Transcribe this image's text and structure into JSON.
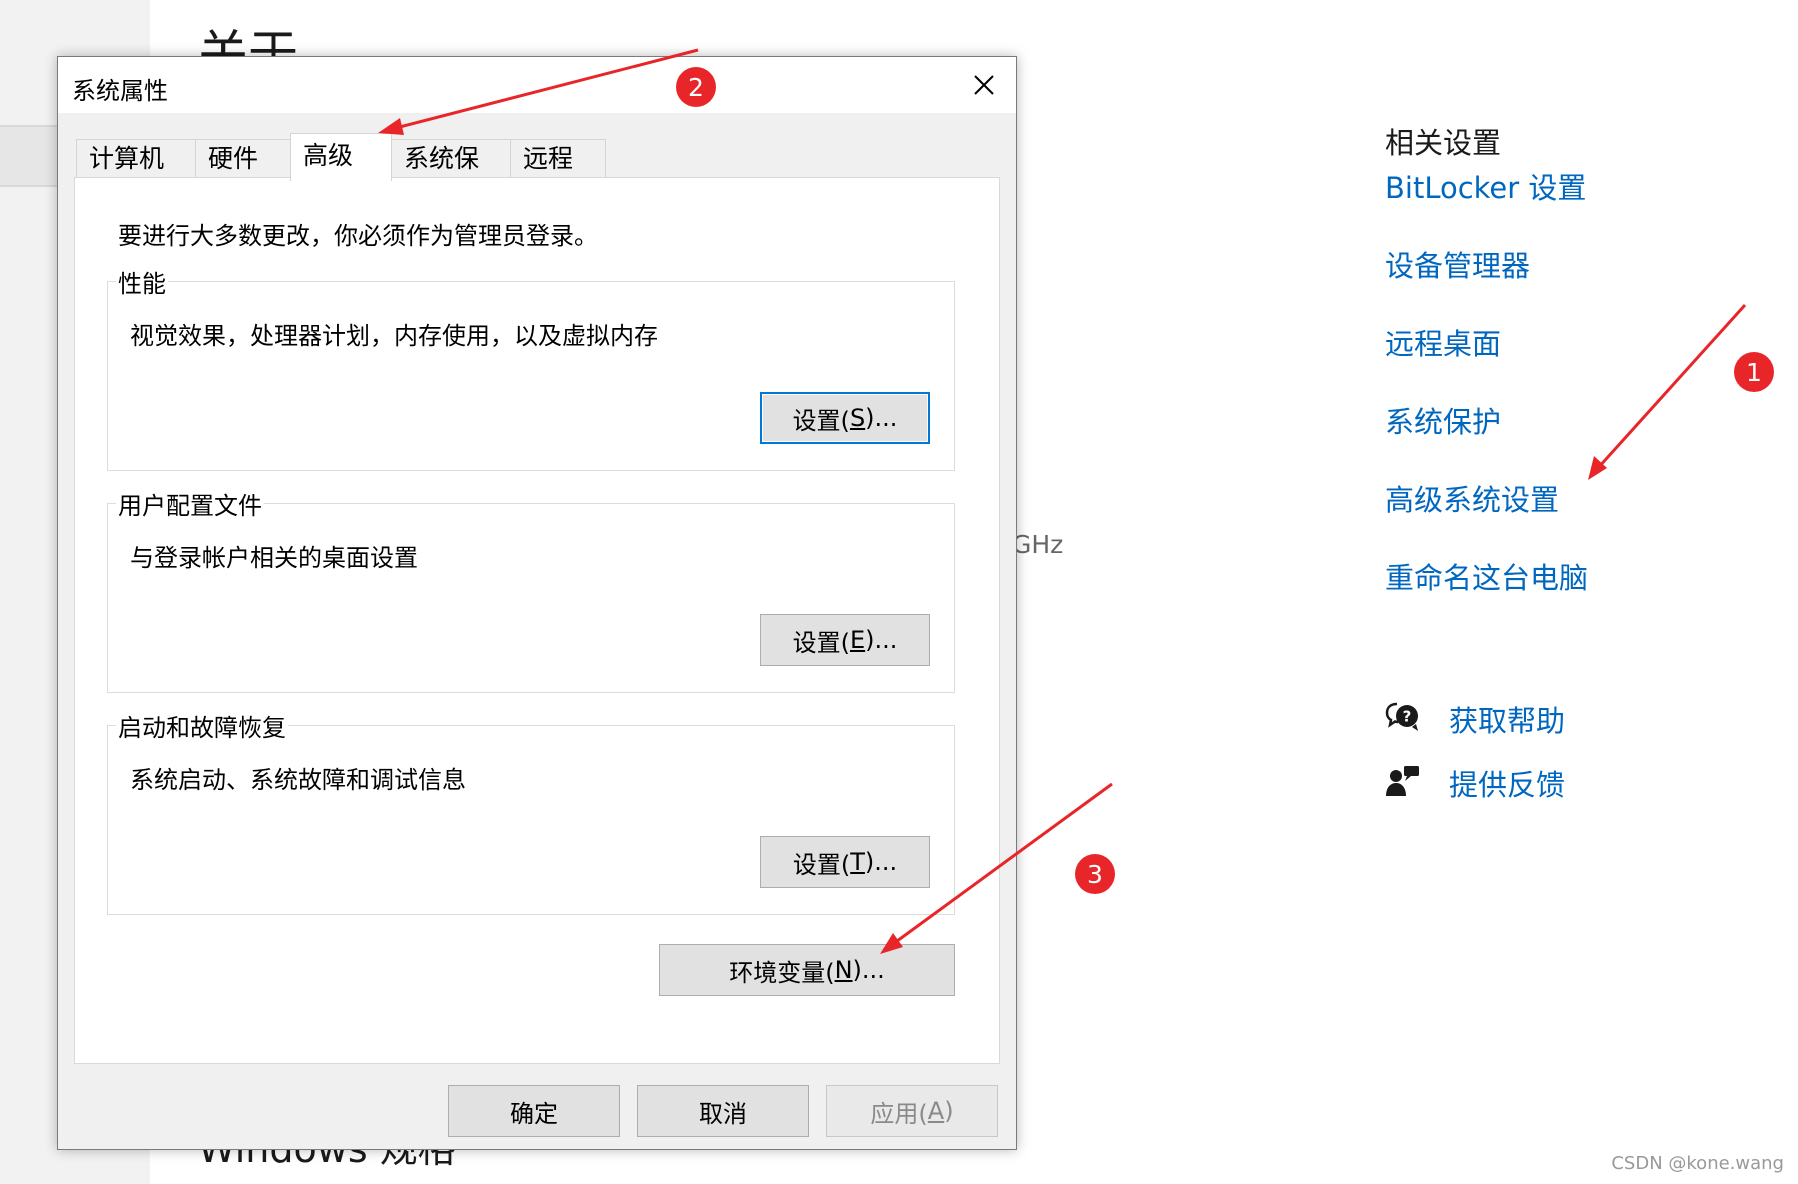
{
  "background": {
    "title": "关于",
    "footer": "Windows 规格",
    "spec_fragment": "GHz",
    "related": {
      "heading": "相关设置",
      "links": [
        "BitLocker 设置",
        "设备管理器",
        "远程桌面",
        "系统保护",
        "高级系统设置",
        "重命名这台电脑"
      ]
    },
    "help": {
      "get_help": "获取帮助",
      "feedback": "提供反馈"
    }
  },
  "dialog": {
    "title": "系统属性",
    "tabs": [
      {
        "label": "计算机名"
      },
      {
        "label": "硬件"
      },
      {
        "label": "高级",
        "active": true
      },
      {
        "label": "系统保护"
      },
      {
        "label": "远程"
      }
    ],
    "admin_note": "要进行大多数更改，你必须作为管理员登录。",
    "groups": {
      "performance": {
        "title": "性能",
        "desc": "视觉效果，处理器计划，内存使用，以及虚拟内存",
        "button_prefix": "设置(",
        "button_key": "S",
        "button_suffix": ")..."
      },
      "user_profiles": {
        "title": "用户配置文件",
        "desc": "与登录帐户相关的桌面设置",
        "button_prefix": "设置(",
        "button_key": "E",
        "button_suffix": ")..."
      },
      "startup": {
        "title": "启动和故障恢复",
        "desc": "系统启动、系统故障和调试信息",
        "button_prefix": "设置(",
        "button_key": "T",
        "button_suffix": ")..."
      }
    },
    "env_button": {
      "prefix": "环境变量(",
      "key": "N",
      "suffix": ")..."
    },
    "buttons": {
      "ok": "确定",
      "cancel": "取消",
      "apply_prefix": "应用(",
      "apply_key": "A",
      "apply_suffix": ")"
    }
  },
  "annotations": {
    "one": "1",
    "two": "2",
    "three": "3"
  },
  "watermark": "CSDN @kone.wang",
  "colors": {
    "link": "#0067c0",
    "badge": "#e8262a",
    "focus": "#0078d7"
  }
}
